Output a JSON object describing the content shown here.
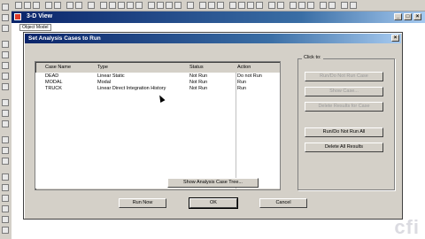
{
  "window": {
    "title": "3-D View",
    "tab": "Object Model"
  },
  "dialog": {
    "title": "Set Analysis Cases to Run",
    "close_label": "×",
    "columns": [
      "Case Name",
      "Type",
      "Status",
      "Action"
    ],
    "rows": [
      {
        "name": "DEAD",
        "type": "Linear Static",
        "status": "Not Run",
        "action": "Do not Run"
      },
      {
        "name": "MODAL",
        "type": "Modal",
        "status": "Not Run",
        "action": "Run"
      },
      {
        "name": "TRUCK",
        "type": "Linear Direct Integration History",
        "status": "Not Run",
        "action": "Run"
      }
    ],
    "click_to_label": "Click to:",
    "buttons": {
      "run_do_not_run_case": "Run/Do Not Run Case",
      "show_case": "Show Case...",
      "delete_results_for_case": "Delete Results for Case",
      "run_do_not_run_all": "Run/Do Not Run All",
      "delete_all_results": "Delete All Results",
      "show_analysis_case_tree": "Show Analysis Case Tree...",
      "run_now": "Run Now",
      "ok": "OK",
      "cancel": "Cancel"
    }
  },
  "watermark": "cfi"
}
